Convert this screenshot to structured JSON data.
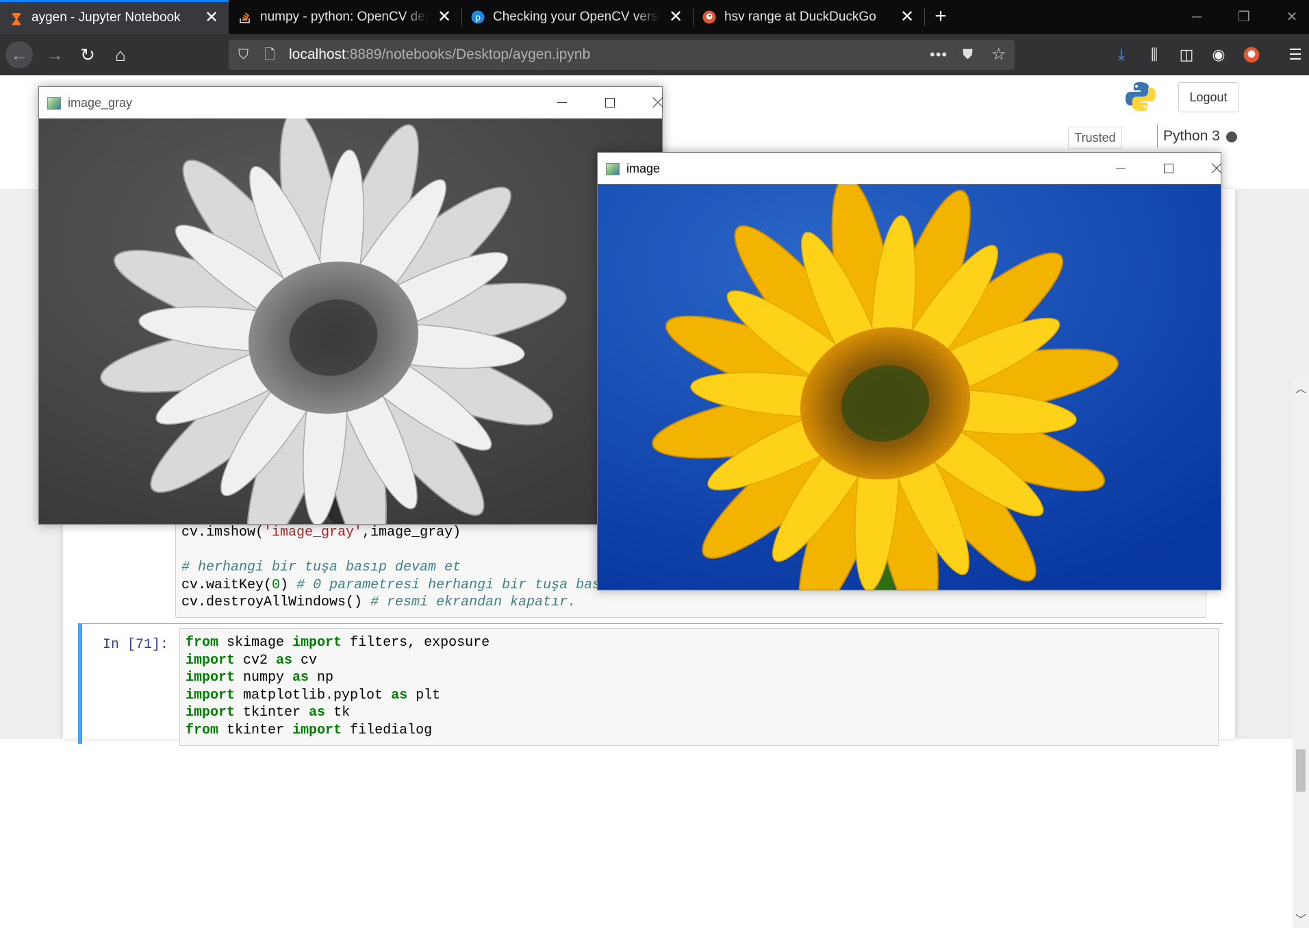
{
  "tabs": [
    {
      "title": "aygen - Jupyter Notebook",
      "icon": "hourglass-icon",
      "active": true
    },
    {
      "title": "numpy - python: OpenCV depth",
      "icon": "stackoverflow-icon",
      "active": false
    },
    {
      "title": "Checking your OpenCV version",
      "icon": "pyimagesearch-icon",
      "active": false
    },
    {
      "title": "hsv range at DuckDuckGo",
      "icon": "duckduckgo-icon",
      "active": false
    }
  ],
  "url": {
    "host": "localhost",
    "rest": ":8889/notebooks/Desktop/aygen.ipynb"
  },
  "jupyter": {
    "logout_label": "Logout",
    "trusted_label": "Trusted",
    "kernel_name": "Python 3"
  },
  "cell2_prompt": "In [71]:",
  "cv_windows": {
    "gray_title": "image_gray",
    "color_title": "image"
  },
  "colors": {
    "tab_accent": "#0a84ff",
    "cell_selected": "#42a5f5",
    "sky": "#0a3fa8",
    "petal": "#f5c400"
  }
}
